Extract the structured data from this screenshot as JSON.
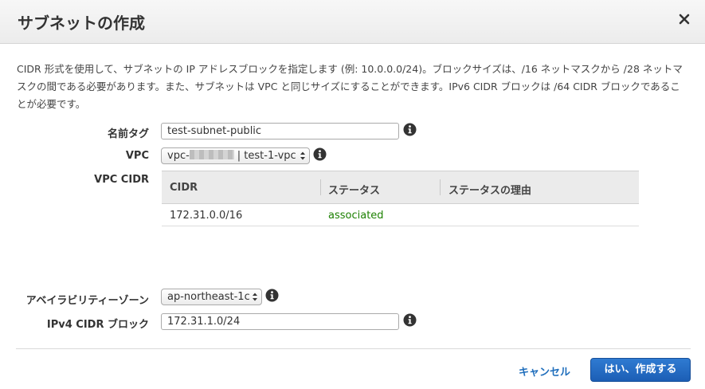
{
  "dialog": {
    "title": "サブネットの作成",
    "description": "CIDR 形式を使用して、サブネットの IP アドレスブロックを指定します (例: 10.0.0.0/24)。ブロックサイズは、/16 ネットマスクから /28 ネットマスクの間である必要があります。また、サブネットは VPC と同じサイズにすることができます。IPv6 CIDR ブロックは /64 CIDR ブロックであることが必要です。"
  },
  "form": {
    "name_tag": {
      "label": "名前タグ",
      "value": "test-subnet-public"
    },
    "vpc": {
      "label": "VPC",
      "prefix": "vpc-",
      "suffix": "| test-1-vpc"
    },
    "vpc_cidr": {
      "label": "VPC CIDR",
      "columns": [
        "CIDR",
        "ステータス",
        "ステータスの理由"
      ],
      "rows": [
        {
          "cidr": "172.31.0.0/16",
          "status": "associated",
          "reason": ""
        }
      ]
    },
    "availability_zone": {
      "label": "アベイラビリティーゾーン",
      "value": "ap-northeast-1c"
    },
    "ipv4_cidr": {
      "label": "IPv4 CIDR ブロック",
      "value": "172.31.1.0/24"
    }
  },
  "footer": {
    "cancel_label": "キャンセル",
    "submit_label": "はい、作成する"
  },
  "colors": {
    "primary_button": "#1c5eb5",
    "link": "#1f6ebc",
    "status_ok": "#1d8102"
  },
  "icons": [
    "close-icon",
    "info-icon",
    "select-arrows-icon"
  ]
}
